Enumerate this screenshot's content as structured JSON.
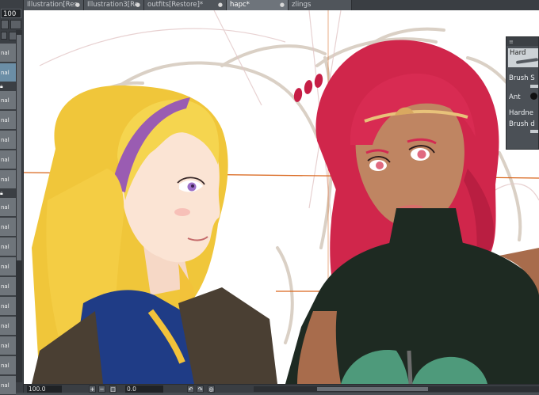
{
  "tabs": [
    {
      "label": "Illustration[Res",
      "active": false
    },
    {
      "label": "Illustration3[Re",
      "active": false
    },
    {
      "label": "outfits[Restore]*",
      "active": false
    },
    {
      "label": "hapc*",
      "active": true
    },
    {
      "label": "zlings",
      "active": false
    }
  ],
  "tab_close_glyph": "●",
  "left_panel": {
    "zoom_value": "100",
    "layer_rows": [
      {
        "label": "nal"
      },
      {
        "label": "nal",
        "active": true
      },
      {
        "label": "nal"
      },
      {
        "label": "nal"
      },
      {
        "label": "nal"
      },
      {
        "label": "nal"
      },
      {
        "label": "nal"
      },
      {
        "label": "nal"
      },
      {
        "label": "nal"
      },
      {
        "label": "nal"
      },
      {
        "label": "nal"
      },
      {
        "label": "nal"
      },
      {
        "label": "nal"
      },
      {
        "label": "nal"
      },
      {
        "label": "nal"
      },
      {
        "label": "nal"
      },
      {
        "label": "nal"
      }
    ]
  },
  "brush_panel": {
    "preset": "Hard",
    "brush_size_label": "Brush S",
    "anti_label": "Ant",
    "hardness_label": "Hardne",
    "brush_density_label": "Brush d"
  },
  "status_bar": {
    "zoom": "100.0",
    "angle": "0.0"
  },
  "colors": {
    "accent_active_layer": "#6b8ea6",
    "guide_line": "#d9661c",
    "blonde_hair": "#f2d34a",
    "red_hair": "#d0264b",
    "headband": "#9a5cb2",
    "dark_top": "#1e2a22"
  }
}
